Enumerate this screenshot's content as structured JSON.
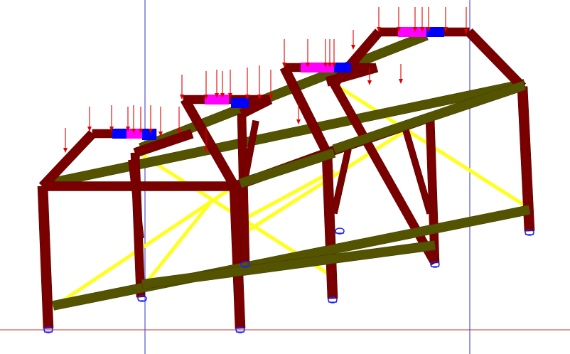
{
  "viewport": {
    "background": "#ffffff",
    "show_guide_lines": true
  },
  "colors": {
    "column_frame": "#7a0000",
    "column_frame_dark": "#5a0000",
    "longitudinal_beam": "#545400",
    "longitudinal_beam_dark": "#3d3d00",
    "bracing": "#ffff1f",
    "load_arrow": "#e00000",
    "support": "#2020ff",
    "guide_vertical": "#3030c8",
    "guide_horizontal": "#c83030",
    "highlight_blue": "#0000ff",
    "highlight_magenta": "#ff00ff"
  },
  "structure": {
    "frames": 4,
    "supports": 8,
    "frame_type": "portal-frame-with-hipped-top"
  }
}
